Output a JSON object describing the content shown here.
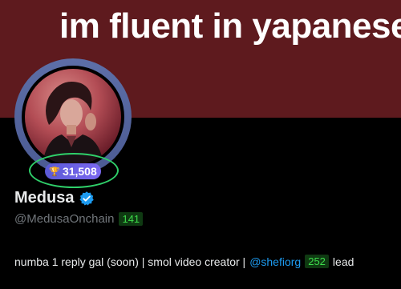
{
  "banner": {
    "text": "im fluent in yapanese",
    "bg_color": "#5e1a1e"
  },
  "profile": {
    "display_name": "Medusa",
    "verified_icon": "verified-badge-icon",
    "verified_color": "#1d9bf0",
    "handle": "@MedusaOnchain",
    "handle_badge": "141",
    "score": "31,508",
    "score_icon": "trophy-icon"
  },
  "bio": {
    "text_before": "numba 1 reply gal (soon) | smol video creator |",
    "mention": "@shefiorg",
    "mention_badge": "252",
    "text_after": "lead"
  },
  "colors": {
    "badge_green": "#3ddc4b",
    "score_pill": "#6b63e6",
    "score_ring": "#2fd06a"
  }
}
